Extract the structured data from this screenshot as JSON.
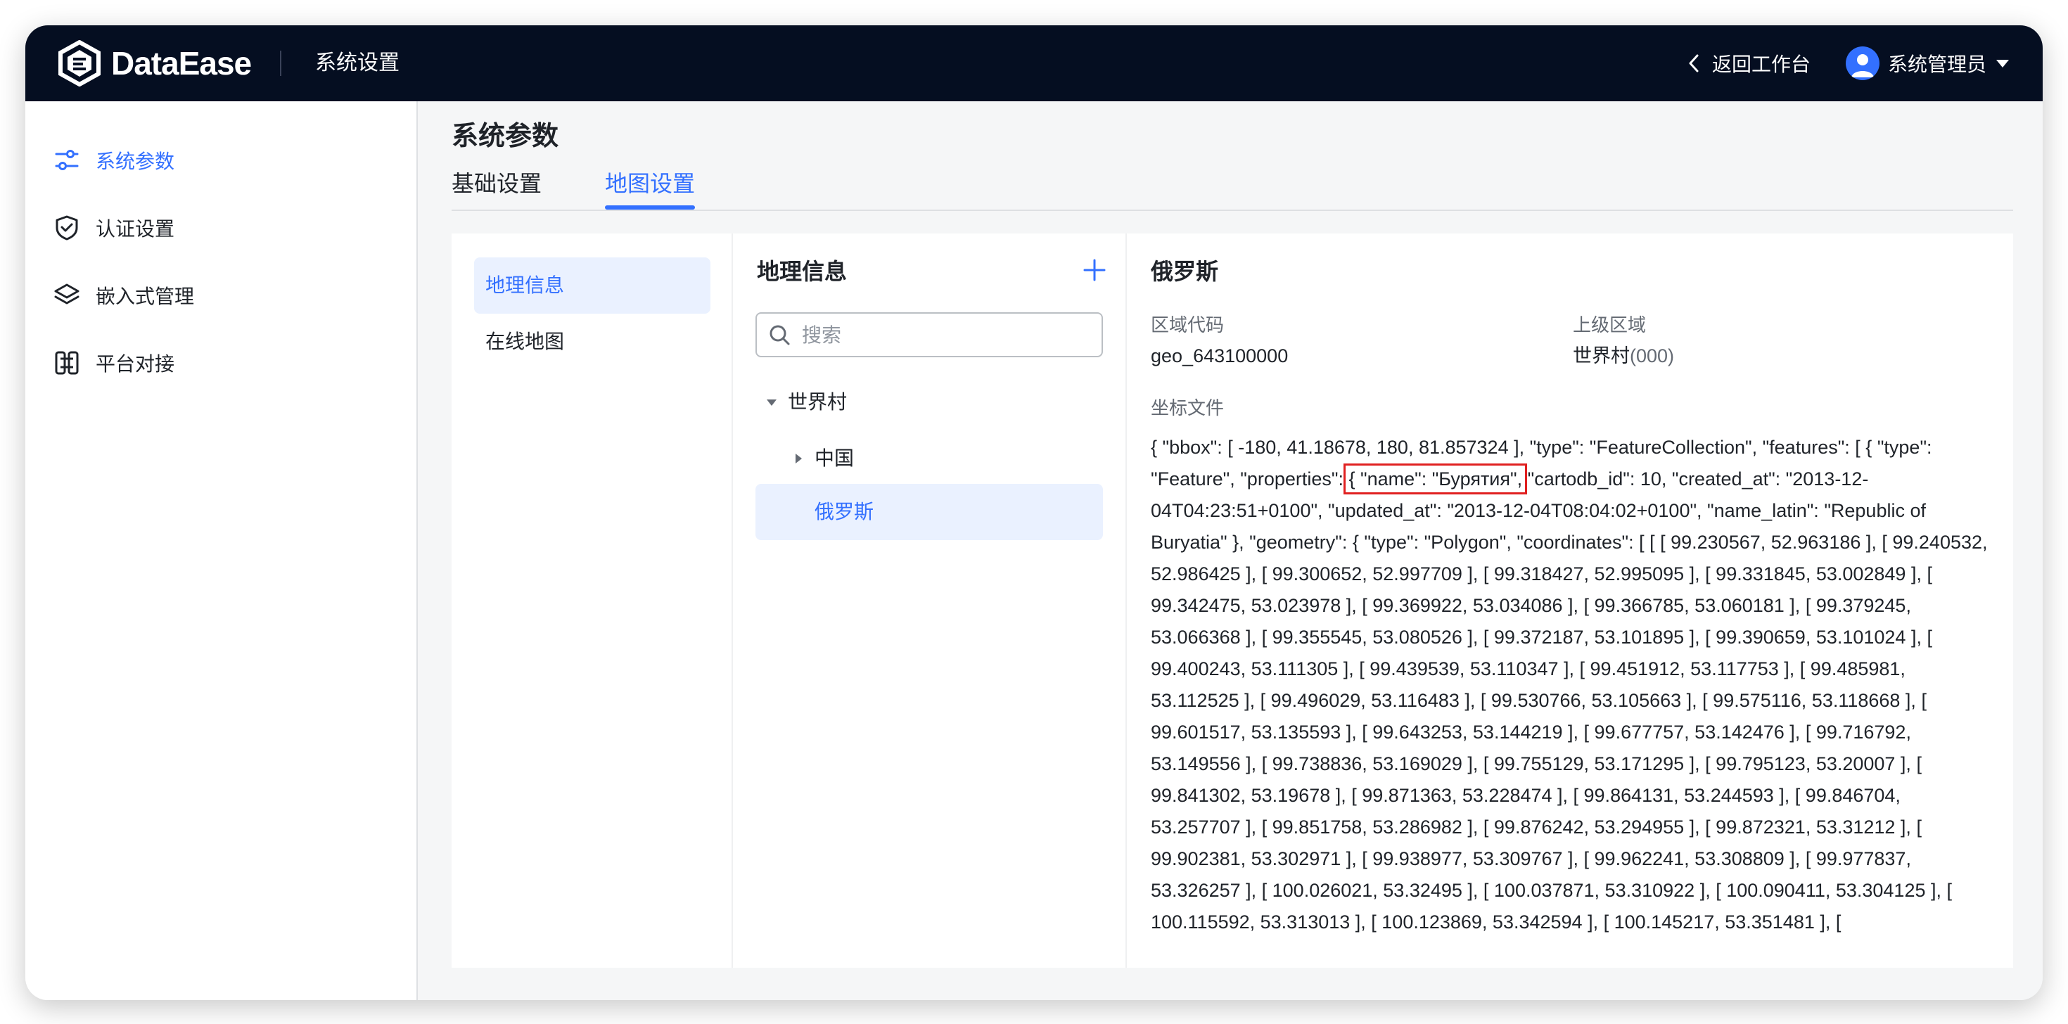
{
  "app": {
    "logo_text": "DataEase",
    "section_title": "系统设置",
    "back_label": "返回工作台",
    "user_name": "系统管理员"
  },
  "sidebar": {
    "items": [
      {
        "label": "系统参数",
        "icon": "sliders-icon",
        "active": true
      },
      {
        "label": "认证设置",
        "icon": "shield-check-icon",
        "active": false
      },
      {
        "label": "嵌入式管理",
        "icon": "layers-icon",
        "active": false
      },
      {
        "label": "平台对接",
        "icon": "link-nodes-icon",
        "active": false
      }
    ]
  },
  "main": {
    "page_title": "系统参数",
    "tabs": [
      {
        "label": "基础设置",
        "active": false
      },
      {
        "label": "地图设置",
        "active": true
      }
    ]
  },
  "subnav": {
    "items": [
      {
        "label": "地理信息",
        "active": true
      },
      {
        "label": "在线地图",
        "active": false
      }
    ]
  },
  "tree": {
    "title": "地理信息",
    "search_placeholder": "搜索",
    "nodes": [
      {
        "label": "世界村",
        "expanded": true,
        "level": 0
      },
      {
        "label": "中国",
        "expanded": false,
        "level": 1
      },
      {
        "label": "俄罗斯",
        "selected": true,
        "level": 1
      }
    ]
  },
  "detail": {
    "title": "俄罗斯",
    "code_label": "区域代码",
    "code_value": "geo_643100000",
    "parent_label": "上级区域",
    "parent_value": "世界村",
    "parent_code": "(000)",
    "coord_label": "坐标文件",
    "coord_prefix": "{ \"bbox\": [ -180, 41.18678, 180, 81.857324 ], \"type\": \"FeatureCollection\", \"features\": [ { \"type\": \"Feature\", \"properties\": ",
    "coord_highlight": "{ \"name\": \"Бурятия\",",
    "coord_suffix": " \"cartodb_id\": 10, \"created_at\": \"2013-12-04T04:23:51+0100\", \"updated_at\": \"2013-12-04T08:04:02+0100\", \"name_latin\": \"Republic of Buryatia\" }, \"geometry\": { \"type\": \"Polygon\", \"coordinates\": [ [ [ 99.230567, 52.963186 ], [ 99.240532, 52.986425 ], [ 99.300652, 52.997709 ], [ 99.318427, 52.995095 ], [ 99.331845, 53.002849 ], [ 99.342475, 53.023978 ], [ 99.369922, 53.034086 ], [ 99.366785, 53.060181 ], [ 99.379245, 53.066368 ], [ 99.355545, 53.080526 ], [ 99.372187, 53.101895 ], [ 99.390659, 53.101024 ], [ 99.400243, 53.111305 ], [ 99.439539, 53.110347 ], [ 99.451912, 53.117753 ], [ 99.485981, 53.112525 ], [ 99.496029, 53.116483 ], [ 99.530766, 53.105663 ], [ 99.575116, 53.118668 ], [ 99.601517, 53.135593 ], [ 99.643253, 53.144219 ], [ 99.677757, 53.142476 ], [ 99.716792, 53.149556 ], [ 99.738836, 53.169029 ], [ 99.755129, 53.171295 ], [ 99.795123, 53.20007 ], [ 99.841302, 53.19678 ], [ 99.871363, 53.228474 ], [ 99.864131, 53.244593 ], [ 99.846704, 53.257707 ], [ 99.851758, 53.286982 ], [ 99.876242, 53.294955 ], [ 99.872321, 53.31212 ], [ 99.902381, 53.302971 ], [ 99.938977, 53.309767 ], [ 99.962241, 53.308809 ], [ 99.977837, 53.326257 ], [ 100.026021, 53.32495 ], [ 100.037871, 53.310922 ], [ 100.090411, 53.304125 ], [ 100.115592, 53.313013 ], [ 100.123869, 53.342594 ], [ 100.145217, 53.351481 ], ["
  },
  "colors": {
    "accent": "#3370ff",
    "topbar": "#050e21",
    "highlight_box": "#e02020"
  }
}
